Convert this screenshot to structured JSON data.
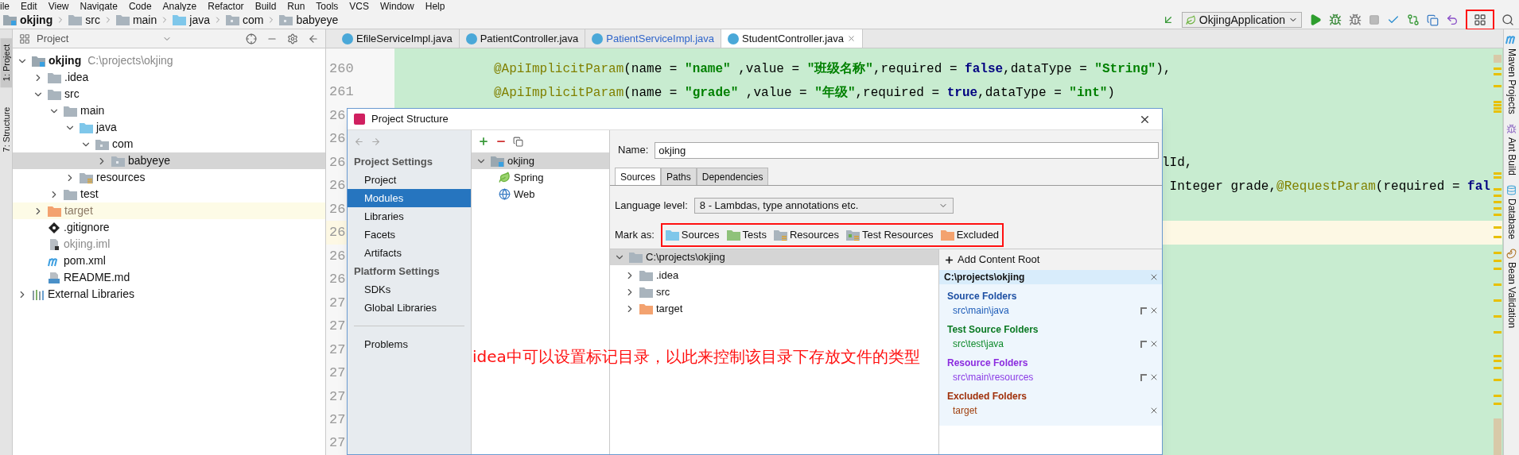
{
  "menu": [
    "ile",
    "Edit",
    "View",
    "Navigate",
    "Code",
    "Analyze",
    "Refactor",
    "Build",
    "Run",
    "Tools",
    "VCS",
    "Window",
    "Help"
  ],
  "breadcrumbs": [
    {
      "label": "okjing",
      "kind": "module"
    },
    {
      "label": "src",
      "kind": "folder"
    },
    {
      "label": "main",
      "kind": "folder"
    },
    {
      "label": "java",
      "kind": "source"
    },
    {
      "label": "com",
      "kind": "package"
    },
    {
      "label": "babyeye",
      "kind": "package"
    }
  ],
  "run_config": {
    "label": "OkjingApplication"
  },
  "left_tool_tabs": [
    {
      "label": "1: Project",
      "selected": true
    },
    {
      "label": "7: Structure",
      "selected": false
    }
  ],
  "project_panel": {
    "title": "Project",
    "tree": [
      {
        "label": "okjing",
        "path": "C:\\projects\\okjing",
        "kind": "module",
        "expanded": true,
        "selected": false,
        "children": [
          {
            "label": ".idea",
            "kind": "folder",
            "expanded": false,
            "selected": false
          },
          {
            "label": "src",
            "kind": "folder",
            "expanded": true,
            "selected": false,
            "children": [
              {
                "label": "main",
                "kind": "folder",
                "expanded": true,
                "selected": false,
                "children": [
                  {
                    "label": "java",
                    "kind": "source",
                    "expanded": true,
                    "selected": false,
                    "children": [
                      {
                        "label": "com",
                        "kind": "package",
                        "expanded": true,
                        "selected": false,
                        "children": [
                          {
                            "label": "babyeye",
                            "kind": "package",
                            "expanded": false,
                            "selected": true
                          }
                        ]
                      }
                    ]
                  },
                  {
                    "label": "resources",
                    "kind": "resources",
                    "expanded": false,
                    "selected": false
                  }
                ]
              },
              {
                "label": "test",
                "kind": "folder",
                "expanded": false,
                "selected": false
              }
            ]
          },
          {
            "label": "target",
            "kind": "excluded",
            "expanded": false,
            "selected": false
          },
          {
            "label": ".gitignore",
            "kind": "git",
            "selected": false
          },
          {
            "label": "okjing.iml",
            "kind": "iml",
            "selected": false
          },
          {
            "label": "pom.xml",
            "kind": "maven",
            "selected": false
          },
          {
            "label": "README.md",
            "kind": "markdown",
            "selected": false
          }
        ]
      },
      {
        "label": "External Libraries",
        "kind": "libraries",
        "expanded": false,
        "selected": false
      }
    ]
  },
  "editor_tabs": [
    {
      "label": "EfileServiceImpl.java",
      "selected": false,
      "modified": false
    },
    {
      "label": "PatientController.java",
      "selected": false,
      "modified": false
    },
    {
      "label": "PatientServiceImpl.java",
      "selected": false,
      "modified": true
    },
    {
      "label": "StudentController.java",
      "selected": true,
      "modified": false
    }
  ],
  "editor": {
    "lines": [
      {
        "number": "260",
        "current": false,
        "tokens": [
          {
            "text": "@ApiImplicitParam",
            "kind": "annotation"
          },
          {
            "text": "(name = ",
            "kind": "plain"
          },
          {
            "text": "\"name\"",
            "kind": "string"
          },
          {
            "text": " ,value = ",
            "kind": "plain"
          },
          {
            "text": "\"班级名称\"",
            "kind": "string"
          },
          {
            "text": ",required = ",
            "kind": "plain"
          },
          {
            "text": "false",
            "kind": "keyword"
          },
          {
            "text": ",dataType = ",
            "kind": "plain"
          },
          {
            "text": "\"String\"",
            "kind": "string"
          },
          {
            "text": "),",
            "kind": "plain"
          }
        ]
      },
      {
        "number": "261",
        "current": false,
        "tokens": [
          {
            "text": "@ApiImplicitParam",
            "kind": "annotation"
          },
          {
            "text": "(name = ",
            "kind": "plain"
          },
          {
            "text": "\"grade\"",
            "kind": "string"
          },
          {
            "text": " ,value = ",
            "kind": "plain"
          },
          {
            "text": "\"年级\"",
            "kind": "string"
          },
          {
            "text": ",required = ",
            "kind": "plain"
          },
          {
            "text": "true",
            "kind": "keyword"
          },
          {
            "text": ",dataType = ",
            "kind": "plain"
          },
          {
            "text": "\"int\"",
            "kind": "string"
          },
          {
            "text": ")",
            "kind": "plain"
          }
        ]
      },
      {
        "number": "26",
        "current": false
      },
      {
        "number": "26",
        "current": false
      },
      {
        "number": "26",
        "current": false,
        "tail": [
          {
            "text": "lId,",
            "kind": "plain"
          }
        ]
      },
      {
        "number": "26",
        "current": false,
        "tail": [
          {
            "text": " Integer grade,",
            "kind": "plain"
          },
          {
            "text": "@RequestParam",
            "kind": "annotation"
          },
          {
            "text": "(required = ",
            "kind": "plain"
          },
          {
            "text": "fal",
            "kind": "keyword"
          }
        ]
      },
      {
        "number": "26",
        "current": false
      },
      {
        "number": "26",
        "current": true
      },
      {
        "number": "26",
        "current": false
      },
      {
        "number": "26",
        "current": false
      },
      {
        "number": "27",
        "current": false
      },
      {
        "number": "27",
        "current": false
      },
      {
        "number": "27",
        "current": false
      },
      {
        "number": "27",
        "current": false
      },
      {
        "number": "27",
        "current": false
      },
      {
        "number": "27",
        "current": false
      },
      {
        "number": "27",
        "current": false
      }
    ]
  },
  "right_tool_tabs": [
    {
      "label": "Maven Projects",
      "kind": "maven"
    },
    {
      "label": "Ant Build",
      "kind": "ant"
    },
    {
      "label": "Database",
      "kind": "database"
    },
    {
      "label": "Bean Validation",
      "kind": "bean"
    }
  ],
  "dialog": {
    "title": "Project Structure",
    "nav": [
      {
        "label": "Project Settings",
        "kind": "heading"
      },
      {
        "label": "Project",
        "kind": "item",
        "selected": false
      },
      {
        "label": "Modules",
        "kind": "item",
        "selected": true
      },
      {
        "label": "Libraries",
        "kind": "item",
        "selected": false
      },
      {
        "label": "Facets",
        "kind": "item",
        "selected": false
      },
      {
        "label": "Artifacts",
        "kind": "item",
        "selected": false
      },
      {
        "label": "Platform Settings",
        "kind": "heading"
      },
      {
        "label": "SDKs",
        "kind": "item",
        "selected": false
      },
      {
        "label": "Global Libraries",
        "kind": "item",
        "selected": false
      },
      {
        "kind": "separator"
      },
      {
        "label": "Problems",
        "kind": "item",
        "selected": false
      }
    ],
    "modules": [
      {
        "label": "okjing",
        "kind": "module",
        "expanded": true,
        "selected": true,
        "children": [
          {
            "label": "Spring",
            "kind": "spring",
            "selected": false
          },
          {
            "label": "Web",
            "kind": "web",
            "selected": false
          }
        ]
      }
    ],
    "name": {
      "label": "Name:",
      "value": "okjing"
    },
    "tabs": [
      {
        "label": "Sources",
        "selected": true
      },
      {
        "label": "Paths",
        "selected": false
      },
      {
        "label": "Dependencies",
        "selected": false
      }
    ],
    "language_level": {
      "label": "Language level:",
      "value": "8 - Lambdas, type annotations etc."
    },
    "mark_as": {
      "label": "Mark as:",
      "options": [
        {
          "label": "Sources",
          "kind": "source"
        },
        {
          "label": "Tests",
          "kind": "test"
        },
        {
          "label": "Resources",
          "kind": "resources"
        },
        {
          "label": "Test Resources",
          "kind": "test-resources"
        },
        {
          "label": "Excluded",
          "kind": "excluded"
        }
      ]
    },
    "content_tree": {
      "root": {
        "label": "C:\\projects\\okjing",
        "selected": true,
        "expanded": true
      },
      "children": [
        {
          "label": ".idea",
          "kind": "folder",
          "expanded": false,
          "selected": false
        },
        {
          "label": "src",
          "kind": "folder",
          "expanded": false,
          "selected": false
        },
        {
          "label": "target",
          "kind": "excluded",
          "expanded": false,
          "selected": false
        }
      ]
    },
    "content_root": {
      "add_label": "Add Content Root",
      "path": "C:\\projects\\okjing",
      "groups": [
        {
          "title": "Source Folders",
          "kind": "source",
          "folders": [
            "src\\main\\java"
          ]
        },
        {
          "title": "Test Source Folders",
          "kind": "test",
          "folders": [
            "src\\test\\java"
          ]
        },
        {
          "title": "Resource Folders",
          "kind": "resources",
          "folders": [
            "src\\main\\resources"
          ]
        },
        {
          "title": "Excluded Folders",
          "kind": "excluded",
          "folders": [
            "target"
          ]
        }
      ]
    },
    "annotation": "idea中可以设置标记目录，以此来控制该目录下存放文件的类型"
  }
}
